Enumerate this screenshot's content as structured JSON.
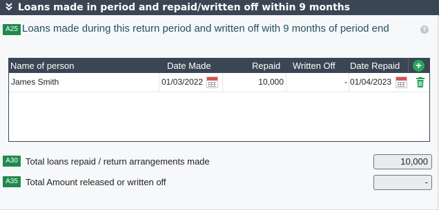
{
  "section": {
    "title": "Loans made in period and repaid/written off within 9 months"
  },
  "loans_table": {
    "ref": "A25",
    "subtitle": "Loans made during this return period and written off with 9 months of period end",
    "columns": {
      "name": "Name of person",
      "date_made": "Date Made",
      "repaid": "Repaid",
      "written_off": "Written Off",
      "date_repaid": "Date Repaid"
    },
    "rows": [
      {
        "name": "James Smith",
        "date_made": "01/03/2022",
        "repaid": "10,000",
        "written_off": "-",
        "date_repaid": "01/04/2023"
      }
    ]
  },
  "totals": [
    {
      "ref": "A30",
      "label": "Total loans repaid / return arrangements made",
      "value": "10,000"
    },
    {
      "ref": "A35",
      "label": "Total Amount released or written off",
      "value": "-"
    }
  ],
  "icons": {
    "header_toggle": "double-chevron-down-icon",
    "help": "question-circle-icon",
    "add": "plus-circle-icon",
    "calendar": "calendar-icon",
    "delete": "trash-icon"
  },
  "colors": {
    "header_bg": "#3a4654",
    "badge_green": "#1f8a4c",
    "add_green": "#2aa55a",
    "subtitle_teal": "#1f4e5f",
    "calendar_red": "#d9534f"
  }
}
